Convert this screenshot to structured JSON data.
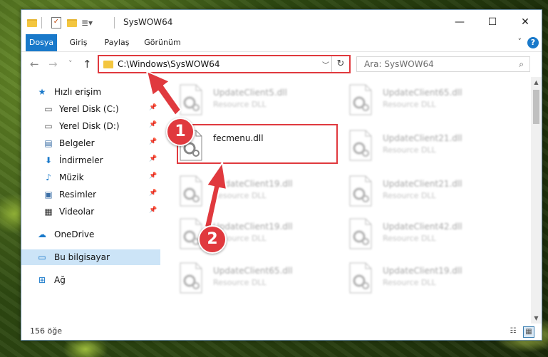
{
  "window": {
    "title": "SysWOW64",
    "minimize": "—",
    "maximize": "☐",
    "close": "✕"
  },
  "ribbon": {
    "tabs": [
      {
        "label": "Dosya",
        "active": true
      },
      {
        "label": "Giriş"
      },
      {
        "label": "Paylaş"
      },
      {
        "label": "Görünüm"
      }
    ],
    "help": "?"
  },
  "nav": {
    "back": "←",
    "forward": "→",
    "recent": "˅",
    "up": "↑",
    "path": "C:\\Windows\\SysWOW64",
    "refresh": "↻",
    "search_placeholder": "Ara: SysWOW64"
  },
  "sidebar": {
    "items": [
      {
        "label": "Hızlı erişim",
        "icon": "star-icon"
      },
      {
        "label": "Yerel Disk (C:)",
        "icon": "drive-icon",
        "pinned": true
      },
      {
        "label": "Yerel Disk (D:)",
        "icon": "drive-icon",
        "pinned": true
      },
      {
        "label": "Belgeler",
        "icon": "document-icon",
        "pinned": true
      },
      {
        "label": "İndirmeler",
        "icon": "download-icon",
        "pinned": true
      },
      {
        "label": "Müzik",
        "icon": "music-icon",
        "pinned": true
      },
      {
        "label": "Resimler",
        "icon": "pictures-icon",
        "pinned": true
      },
      {
        "label": "Videolar",
        "icon": "video-icon",
        "pinned": true
      },
      {
        "label": "OneDrive",
        "icon": "cloud-icon"
      },
      {
        "label": "Bu bilgisayar",
        "icon": "computer-icon",
        "selected": true
      },
      {
        "label": "Ağ",
        "icon": "network-icon"
      }
    ]
  },
  "files": {
    "left": [
      {
        "name": "UpdateClient5.dll",
        "type": "Resource DLL"
      },
      {
        "name": "fecmenu.dll",
        "type": ""
      },
      {
        "name": "UpdateClient19.dll",
        "type": "Resource DLL"
      },
      {
        "name": "UpdateClient19.dll",
        "type": "Resource DLL"
      },
      {
        "name": "UpdateClient65.dll",
        "type": "Resource DLL"
      }
    ],
    "right": [
      {
        "name": "UpdateClient65.dll",
        "type": "Resource DLL"
      },
      {
        "name": "UpdateClient21.dll",
        "type": "Resource DLL"
      },
      {
        "name": "UpdateClient21.dll",
        "type": "Resource DLL"
      },
      {
        "name": "UpdateClient42.dll",
        "type": "Resource DLL"
      },
      {
        "name": "UpdateClient19.dll",
        "type": "Resource DLL"
      }
    ]
  },
  "status": {
    "count": "156 öğe"
  },
  "callouts": [
    "1",
    "2"
  ],
  "colors": {
    "accent": "#1979ca",
    "highlight": "#e0393e",
    "selection": "#cce4f7"
  }
}
